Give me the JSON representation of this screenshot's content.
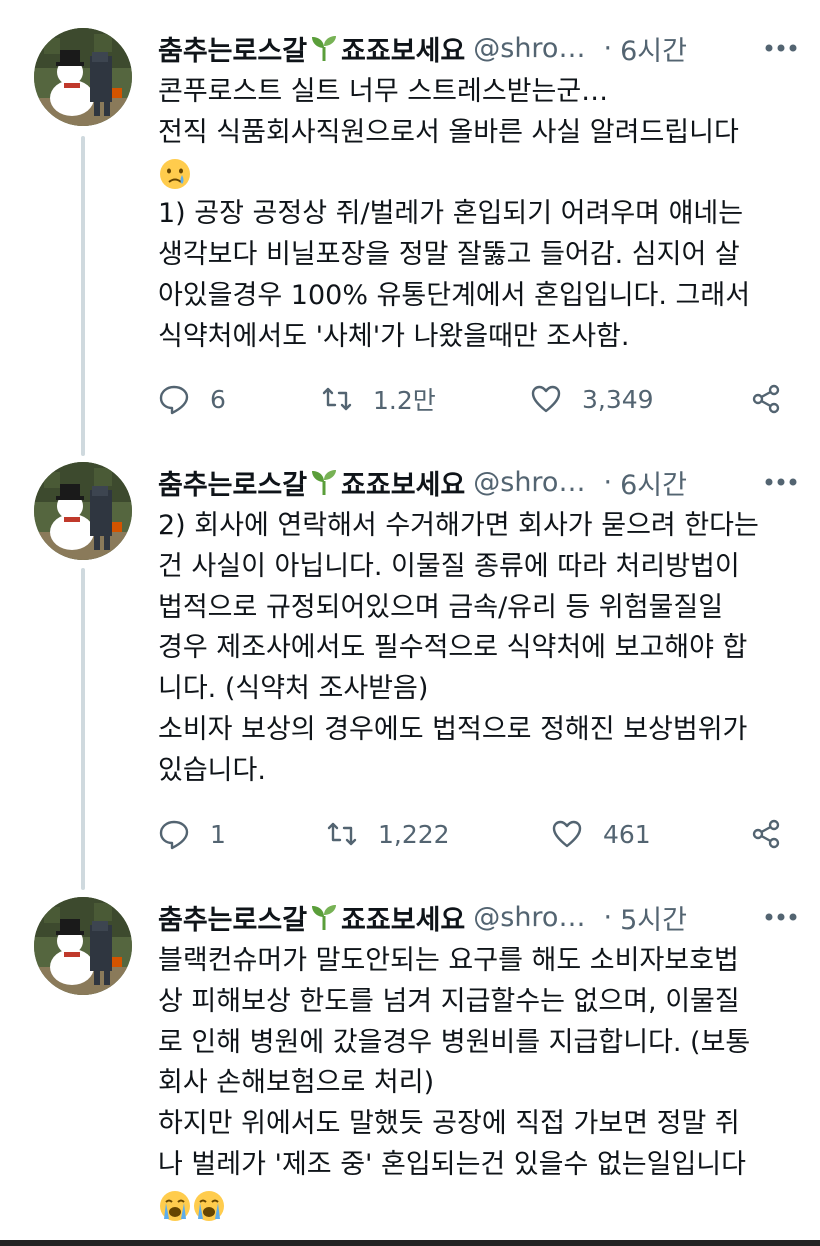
{
  "user": {
    "name_part1": "춤추는로스갈",
    "name_part2": "죠죠보세요",
    "handle": "@shro…",
    "separator": "·"
  },
  "tweets": [
    {
      "time": "6시간",
      "lines": [
        "콘푸로스트 실트 너무 스트레스받는군…",
        "전직 식품회사직원으로서 올바른 사실 알려드립니다",
        "",
        "1) 공장 공정상 쥐/벌레가 혼입되기 어려우며 얘네는",
        "생각보다 비닐포장을 정말 잘뚫고 들어감. 심지어 살",
        "아있을경우 100% 유통단계에서 혼입입니다. 그래서",
        "식약처에서도 '사체'가 나왔을때만 조사함."
      ],
      "emojis": [
        "crying-face-emoji"
      ],
      "replies": "6",
      "retweets": "1.2만",
      "likes": "3,349"
    },
    {
      "time": "6시간",
      "lines": [
        "2) 회사에 연락해서 수거해가면 회사가 묻으려 한다는",
        "건 사실이 아닙니다. 이물질 종류에 따라 처리방법이",
        "법적으로 규정되어있으며 금속/유리 등 위험물질일",
        "경우 제조사에서도 필수적으로 식약처에 보고해야 합",
        "니다. (식약처 조사받음)",
        "소비자 보상의 경우에도 법적으로 정해진 보상범위가",
        "있습니다."
      ],
      "replies": "1",
      "retweets": "1,222",
      "likes": "461"
    },
    {
      "time": "5시간",
      "lines": [
        "블랙컨슈머가 말도안되는 요구를 해도 소비자보호법",
        "상 피해보상 한도를 넘겨 지급할수는 없으며, 이물질",
        "로 인해 병원에 갔을경우 병원비를 지급합니다. (보통",
        "회사 손해보험으로 처리)",
        "하지만 위에서도 말했듯 공장에 직접 가보면 정말 쥐",
        "나 벌레가 '제조 중' 혼입되는건 있을수 없는일입니다"
      ],
      "emojis": [
        "loudly-crying-face-emoji",
        "loudly-crying-face-emoji"
      ]
    }
  ],
  "colors": {
    "text": "#0f1419",
    "secondary": "#536471",
    "thread_line": "#cfd9de",
    "sprout_green": "#5a9e3a"
  }
}
